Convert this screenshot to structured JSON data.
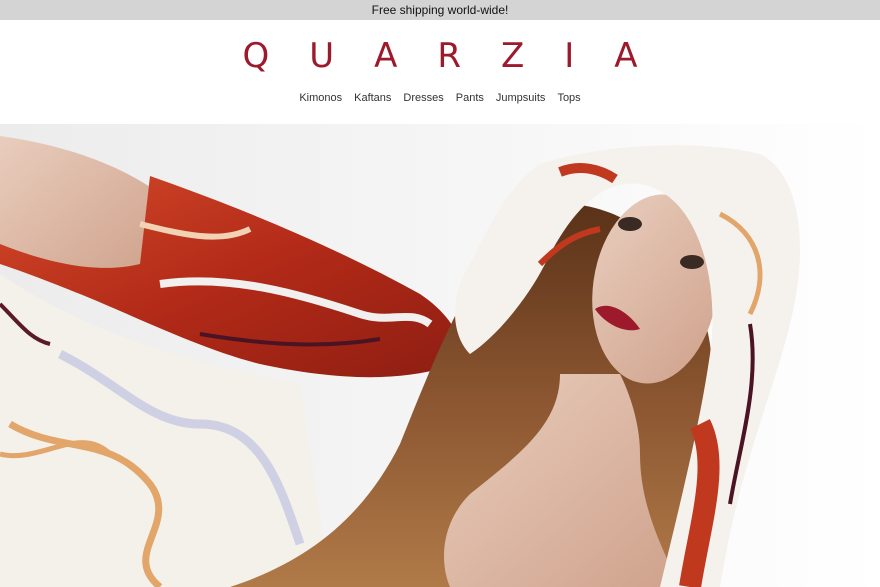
{
  "promo": {
    "text": "Free shipping world-wide!"
  },
  "brand": {
    "name": "QUARZIA",
    "color": "#9d1a2c"
  },
  "nav": {
    "items": [
      {
        "label": "Kimonos"
      },
      {
        "label": "Kaftans"
      },
      {
        "label": "Dresses"
      },
      {
        "label": "Pants"
      },
      {
        "label": "Jumpsuits"
      },
      {
        "label": "Tops"
      }
    ]
  },
  "colors": {
    "promo_bg": "#d4d4d4",
    "silk_red": "#c0391f",
    "silk_white": "#f5f2ee",
    "hair": "#7a4a28",
    "skin": "#e2c4b2"
  }
}
